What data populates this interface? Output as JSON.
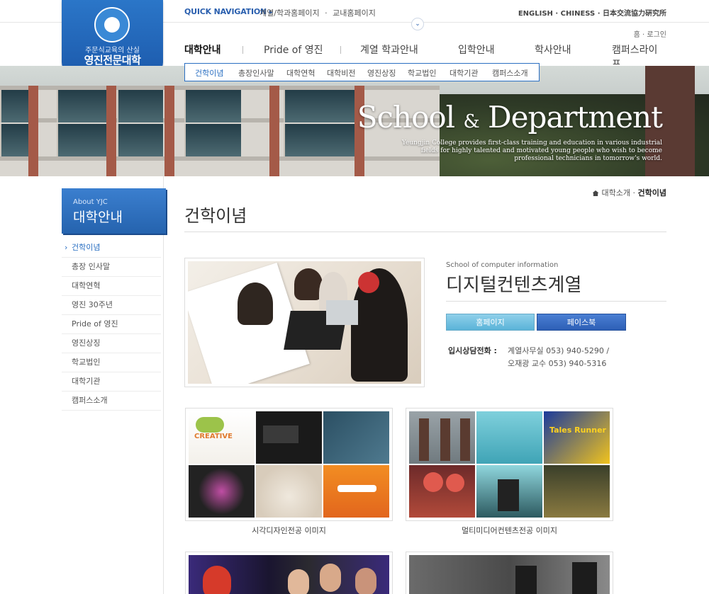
{
  "quick_nav": {
    "title": "QUICK NAVIGATION ▸",
    "links": [
      "계열/학과홈페이지",
      "교내홈페이지"
    ],
    "separator": "·"
  },
  "languages": "ENGLISH · CHINESS · 日本交流協力硏究所",
  "logo": {
    "slogan": "주문식교육의 산실",
    "name": "영진전문대학"
  },
  "util": "홈 · 로그인",
  "gnb": [
    "대학안내",
    "Pride of 영진",
    "계열 학과안내",
    "입학안내",
    "학사안내",
    "캠퍼스라이프"
  ],
  "lnb": [
    "건학이념",
    "총장인사말",
    "대학연혁",
    "대학비전",
    "영진상징",
    "학교법인",
    "대학기관",
    "캠퍼스소개"
  ],
  "banner": {
    "title_a": "School",
    "title_amp": "&",
    "title_b": "Department",
    "subtitle": "Yeungjin College provides first-class training and education in various industrial fields for highly talented and motivated young people who wish to become professional technicians in tomorrow's world."
  },
  "sidebar": {
    "head_en": "About YJC",
    "head_ko": "대학안내",
    "items": [
      "건학이념",
      "총장 인사말",
      "대학연혁",
      "영진 30주년",
      "Pride of 영진",
      "영진상징",
      "학교법인",
      "대학기관",
      "캠퍼스소개"
    ]
  },
  "breadcrumb": {
    "parent": "대학소개",
    "sep": "·",
    "current": "건학이념"
  },
  "page_title": "건학이념",
  "dept": {
    "en": "School of computer information",
    "ko": "디지털컨텐츠계열",
    "btn_home": "홈페이지",
    "btn_facebook": "페이스북",
    "contact_label": "입시상담전화 :",
    "contact_1": "계열사무실 053) 940-5290 /",
    "contact_2": "오재광 교수 053) 940-5316"
  },
  "gallery": {
    "caption_1": "시각디자인전공 이미지",
    "caption_2": "멀티미디어컨텐츠전공 이미지"
  }
}
